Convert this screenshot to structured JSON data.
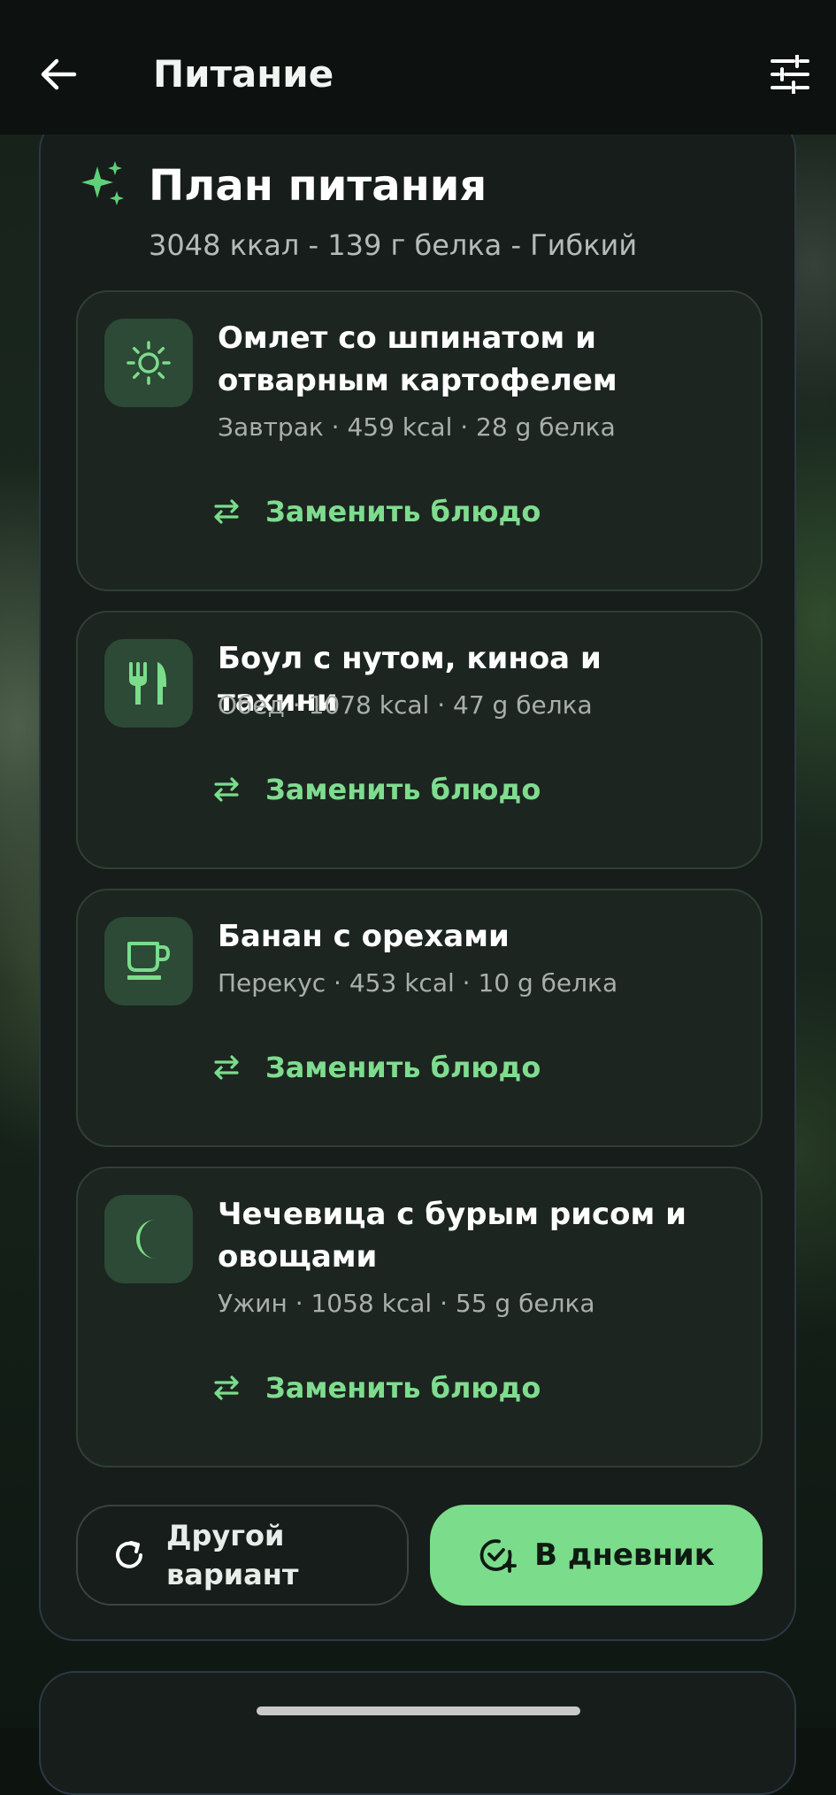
{
  "header": {
    "title": "Питание"
  },
  "plan": {
    "title": "План питания",
    "summary": "3048 ккал - 139 г белка - Гибкий",
    "replace_label": "Заменить блюдо",
    "meals": [
      {
        "name": "Омлет со шпинатом и отварным картофелем",
        "meta": "Завтрак · 459 kcal · 28 g белка",
        "icon": "sun-icon"
      },
      {
        "name": "Боул с нутом, киноа и тахини",
        "meta": "Обед · 1078 kcal · 47 g белка",
        "icon": "cutlery-icon"
      },
      {
        "name": "Банан с орехами",
        "meta": "Перекус · 453 kcal · 10 g белка",
        "icon": "cup-icon"
      },
      {
        "name": "Чечевица с бурым рисом и овощами",
        "meta": "Ужин · 1058 kcal · 55 g белка",
        "icon": "moon-icon"
      }
    ],
    "alt_button": "Другой вариант",
    "diary_button": "В дневник"
  },
  "colors": {
    "accent": "#7bdc8b",
    "card": "#171d1a",
    "meal_card": "#1c2520"
  }
}
